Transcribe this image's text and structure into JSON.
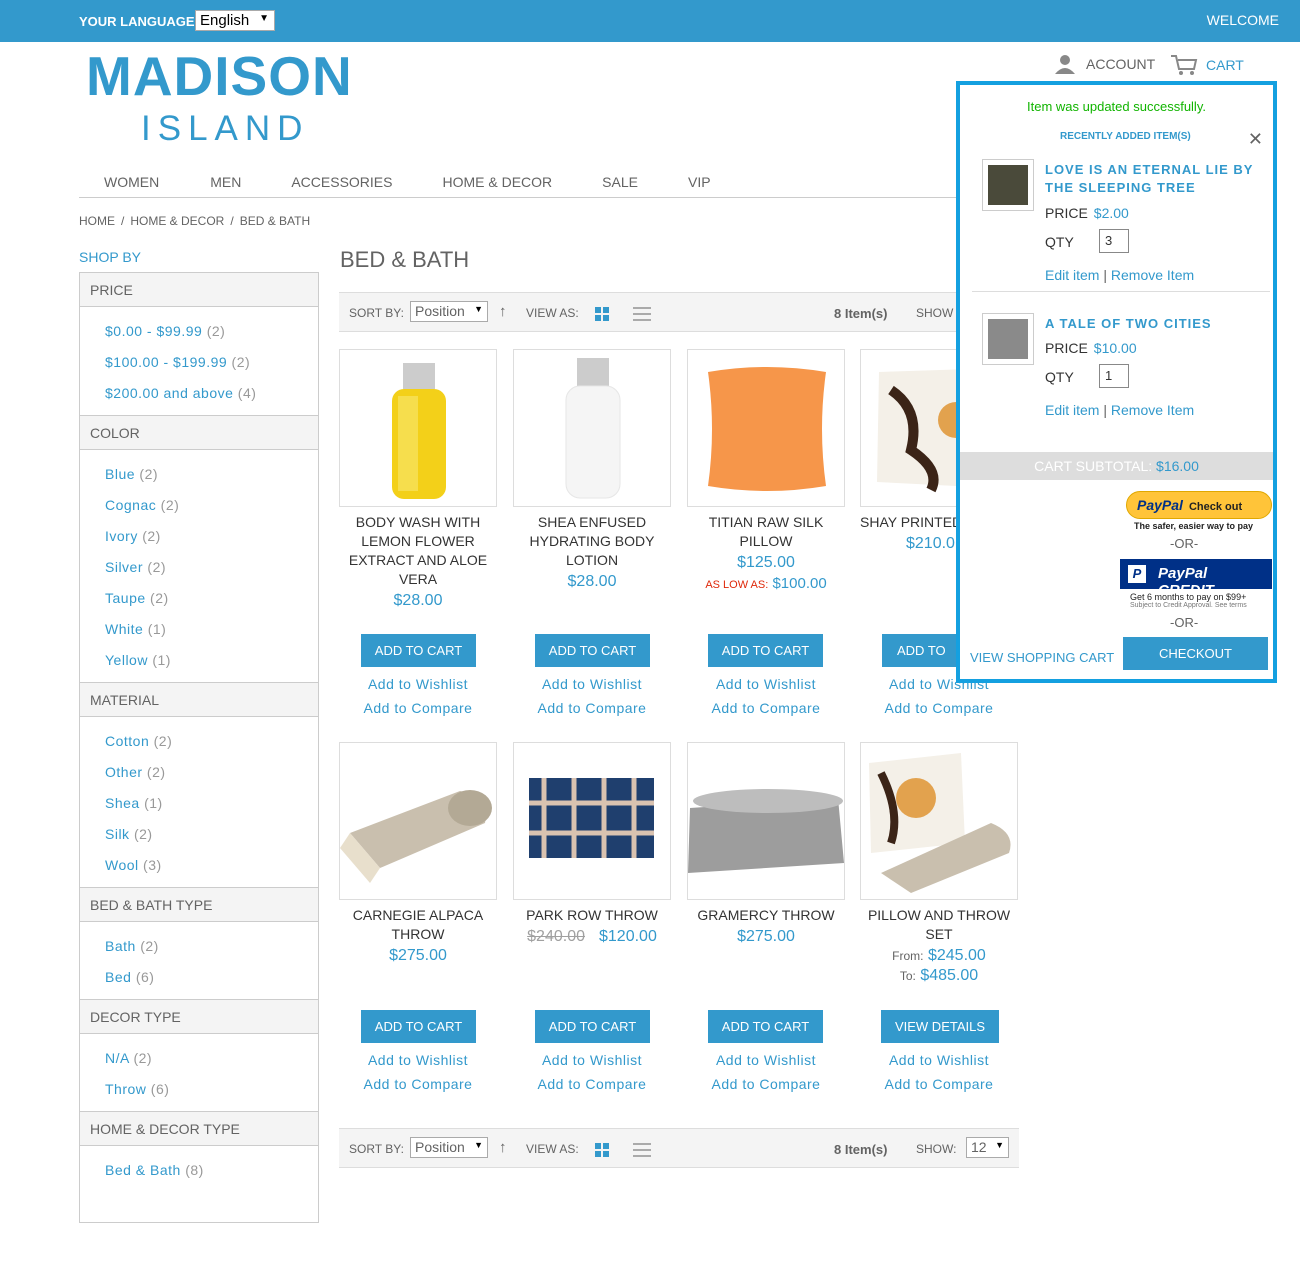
{
  "header": {
    "language_label": "YOUR LANGUAGE:",
    "language_value": "English",
    "welcome": "WELCOME",
    "logo_line1": "MADISON",
    "logo_line2": "ISLAND",
    "account": "ACCOUNT",
    "cart": "CART"
  },
  "nav": [
    "WOMEN",
    "MEN",
    "ACCESSORIES",
    "HOME & DECOR",
    "SALE",
    "VIP"
  ],
  "breadcrumb": [
    "HOME",
    "/",
    "HOME & DECOR",
    "/",
    "BED & BATH"
  ],
  "sidebar": {
    "title": "SHOP BY",
    "filters": [
      {
        "name": "PRICE",
        "options": [
          {
            "label": "$0.00 - $99.99",
            "count": "(2)"
          },
          {
            "label": "$100.00 - $199.99",
            "count": "(2)"
          },
          {
            "label": "$200.00 and above",
            "count": "(4)"
          }
        ]
      },
      {
        "name": "COLOR",
        "options": [
          {
            "label": "Blue",
            "count": "(2)"
          },
          {
            "label": "Cognac",
            "count": "(2)"
          },
          {
            "label": "Ivory",
            "count": "(2)"
          },
          {
            "label": "Silver",
            "count": "(2)"
          },
          {
            "label": "Taupe",
            "count": "(2)"
          },
          {
            "label": "White",
            "count": "(1)"
          },
          {
            "label": "Yellow",
            "count": "(1)"
          }
        ]
      },
      {
        "name": "MATERIAL",
        "options": [
          {
            "label": "Cotton",
            "count": "(2)"
          },
          {
            "label": "Other",
            "count": "(2)"
          },
          {
            "label": "Shea",
            "count": "(1)"
          },
          {
            "label": "Silk",
            "count": "(2)"
          },
          {
            "label": "Wool",
            "count": "(3)"
          }
        ]
      },
      {
        "name": "BED & BATH TYPE",
        "options": [
          {
            "label": "Bath",
            "count": "(2)"
          },
          {
            "label": "Bed",
            "count": "(6)"
          }
        ]
      },
      {
        "name": "DECOR TYPE",
        "options": [
          {
            "label": "N/A",
            "count": "(2)"
          },
          {
            "label": "Throw",
            "count": "(6)"
          }
        ]
      },
      {
        "name": "HOME & DECOR TYPE",
        "options": [
          {
            "label": "Bed & Bath",
            "count": "(8)"
          }
        ]
      }
    ]
  },
  "page_title": "BED & BATH",
  "toolbar": {
    "sort_label": "SORT BY:",
    "sort_value": "Position",
    "view_label": "VIEW AS:",
    "count": "8 Item(s)",
    "show_label": "SHOW:",
    "show_value": "12",
    "show_label_top": "SHOW"
  },
  "products": [
    {
      "name": "Body Wash with Lemon Flower Extract and Aloe Vera",
      "price": "$28.00",
      "button": "ADD TO CART",
      "wishlist": "Add to Wishlist",
      "compare": "Add to Compare"
    },
    {
      "name": "Shea Enfused Hydrating Body Lotion",
      "price": "$28.00",
      "button": "ADD TO CART",
      "wishlist": "Add to Wishlist",
      "compare": "Add to Compare"
    },
    {
      "name": "Titian Raw Silk Pillow",
      "price": "$125.00",
      "low_label": "AS LOW AS:",
      "low_price": "$100.00",
      "button": "ADD TO CART",
      "wishlist": "Add to Wishlist",
      "compare": "Add to Compare"
    },
    {
      "name": "Shay Printed",
      "price": "$210.0",
      "button": "ADD TO C",
      "wishlist": "Add to Wishlist",
      "compare": "Add to Compare"
    },
    {
      "name": "Carnegie Alpaca Throw",
      "price": "$275.00",
      "button": "ADD TO CART",
      "wishlist": "Add to Wishlist",
      "compare": "Add to Compare"
    },
    {
      "name": "Park Row Throw",
      "old_price": "$240.00",
      "price": "$120.00",
      "button": "ADD TO CART",
      "wishlist": "Add to Wishlist",
      "compare": "Add to Compare"
    },
    {
      "name": "Gramercy Throw",
      "price": "$275.00",
      "button": "ADD TO CART",
      "wishlist": "Add to Wishlist",
      "compare": "Add to Compare"
    },
    {
      "name": "Pillow and Throw Set",
      "from_label": "From:",
      "from_price": "$245.00",
      "to_label": "To:",
      "to_price": "$485.00",
      "button": "VIEW DETAILS",
      "wishlist": "Add to Wishlist",
      "compare": "Add to Compare"
    }
  ],
  "minicart": {
    "message": "Item was updated successfully.",
    "recent": "RECENTLY ADDED ITEM(S)",
    "close": "✕",
    "items": [
      {
        "name": "LOVE IS AN ETERNAL LIE BY THE SLEEPING TREE",
        "price_label": "PRICE",
        "price": "$2.00",
        "qty_label": "QTY",
        "qty": "3",
        "edit": "Edit item",
        "sep": "|",
        "remove": "Remove Item"
      },
      {
        "name": "A TALE OF TWO CITIES",
        "price_label": "PRICE",
        "price": "$10.00",
        "qty_label": "QTY",
        "qty": "1",
        "edit": "Edit item",
        "sep": "|",
        "remove": "Remove Item"
      }
    ],
    "subtotal_label": "CART SUBTOTAL:",
    "subtotal": "$16.00",
    "paypal_label": "PayPal",
    "paypal_checkout": "Check out",
    "paypal_tagline": "The safer, easier way to pay",
    "or": "-OR-",
    "paypal_credit": "PayPal CREDIT",
    "credit_line1": "Get 6 months to pay on $99+",
    "credit_line2": "Subject to Credit Approval. See terms",
    "view_cart": "VIEW SHOPPING CART",
    "checkout": "CHECKOUT"
  }
}
